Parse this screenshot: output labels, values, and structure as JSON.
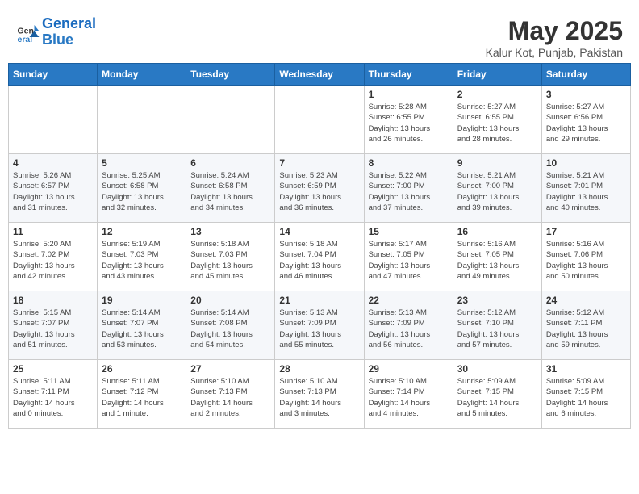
{
  "header": {
    "logo_line1": "General",
    "logo_line2": "Blue",
    "month": "May 2025",
    "location": "Kalur Kot, Punjab, Pakistan"
  },
  "days_of_week": [
    "Sunday",
    "Monday",
    "Tuesday",
    "Wednesday",
    "Thursday",
    "Friday",
    "Saturday"
  ],
  "weeks": [
    [
      {
        "day": "",
        "info": ""
      },
      {
        "day": "",
        "info": ""
      },
      {
        "day": "",
        "info": ""
      },
      {
        "day": "",
        "info": ""
      },
      {
        "day": "1",
        "info": "Sunrise: 5:28 AM\nSunset: 6:55 PM\nDaylight: 13 hours\nand 26 minutes."
      },
      {
        "day": "2",
        "info": "Sunrise: 5:27 AM\nSunset: 6:55 PM\nDaylight: 13 hours\nand 28 minutes."
      },
      {
        "day": "3",
        "info": "Sunrise: 5:27 AM\nSunset: 6:56 PM\nDaylight: 13 hours\nand 29 minutes."
      }
    ],
    [
      {
        "day": "4",
        "info": "Sunrise: 5:26 AM\nSunset: 6:57 PM\nDaylight: 13 hours\nand 31 minutes."
      },
      {
        "day": "5",
        "info": "Sunrise: 5:25 AM\nSunset: 6:58 PM\nDaylight: 13 hours\nand 32 minutes."
      },
      {
        "day": "6",
        "info": "Sunrise: 5:24 AM\nSunset: 6:58 PM\nDaylight: 13 hours\nand 34 minutes."
      },
      {
        "day": "7",
        "info": "Sunrise: 5:23 AM\nSunset: 6:59 PM\nDaylight: 13 hours\nand 36 minutes."
      },
      {
        "day": "8",
        "info": "Sunrise: 5:22 AM\nSunset: 7:00 PM\nDaylight: 13 hours\nand 37 minutes."
      },
      {
        "day": "9",
        "info": "Sunrise: 5:21 AM\nSunset: 7:00 PM\nDaylight: 13 hours\nand 39 minutes."
      },
      {
        "day": "10",
        "info": "Sunrise: 5:21 AM\nSunset: 7:01 PM\nDaylight: 13 hours\nand 40 minutes."
      }
    ],
    [
      {
        "day": "11",
        "info": "Sunrise: 5:20 AM\nSunset: 7:02 PM\nDaylight: 13 hours\nand 42 minutes."
      },
      {
        "day": "12",
        "info": "Sunrise: 5:19 AM\nSunset: 7:03 PM\nDaylight: 13 hours\nand 43 minutes."
      },
      {
        "day": "13",
        "info": "Sunrise: 5:18 AM\nSunset: 7:03 PM\nDaylight: 13 hours\nand 45 minutes."
      },
      {
        "day": "14",
        "info": "Sunrise: 5:18 AM\nSunset: 7:04 PM\nDaylight: 13 hours\nand 46 minutes."
      },
      {
        "day": "15",
        "info": "Sunrise: 5:17 AM\nSunset: 7:05 PM\nDaylight: 13 hours\nand 47 minutes."
      },
      {
        "day": "16",
        "info": "Sunrise: 5:16 AM\nSunset: 7:05 PM\nDaylight: 13 hours\nand 49 minutes."
      },
      {
        "day": "17",
        "info": "Sunrise: 5:16 AM\nSunset: 7:06 PM\nDaylight: 13 hours\nand 50 minutes."
      }
    ],
    [
      {
        "day": "18",
        "info": "Sunrise: 5:15 AM\nSunset: 7:07 PM\nDaylight: 13 hours\nand 51 minutes."
      },
      {
        "day": "19",
        "info": "Sunrise: 5:14 AM\nSunset: 7:07 PM\nDaylight: 13 hours\nand 53 minutes."
      },
      {
        "day": "20",
        "info": "Sunrise: 5:14 AM\nSunset: 7:08 PM\nDaylight: 13 hours\nand 54 minutes."
      },
      {
        "day": "21",
        "info": "Sunrise: 5:13 AM\nSunset: 7:09 PM\nDaylight: 13 hours\nand 55 minutes."
      },
      {
        "day": "22",
        "info": "Sunrise: 5:13 AM\nSunset: 7:09 PM\nDaylight: 13 hours\nand 56 minutes."
      },
      {
        "day": "23",
        "info": "Sunrise: 5:12 AM\nSunset: 7:10 PM\nDaylight: 13 hours\nand 57 minutes."
      },
      {
        "day": "24",
        "info": "Sunrise: 5:12 AM\nSunset: 7:11 PM\nDaylight: 13 hours\nand 59 minutes."
      }
    ],
    [
      {
        "day": "25",
        "info": "Sunrise: 5:11 AM\nSunset: 7:11 PM\nDaylight: 14 hours\nand 0 minutes."
      },
      {
        "day": "26",
        "info": "Sunrise: 5:11 AM\nSunset: 7:12 PM\nDaylight: 14 hours\nand 1 minute."
      },
      {
        "day": "27",
        "info": "Sunrise: 5:10 AM\nSunset: 7:13 PM\nDaylight: 14 hours\nand 2 minutes."
      },
      {
        "day": "28",
        "info": "Sunrise: 5:10 AM\nSunset: 7:13 PM\nDaylight: 14 hours\nand 3 minutes."
      },
      {
        "day": "29",
        "info": "Sunrise: 5:10 AM\nSunset: 7:14 PM\nDaylight: 14 hours\nand 4 minutes."
      },
      {
        "day": "30",
        "info": "Sunrise: 5:09 AM\nSunset: 7:15 PM\nDaylight: 14 hours\nand 5 minutes."
      },
      {
        "day": "31",
        "info": "Sunrise: 5:09 AM\nSunset: 7:15 PM\nDaylight: 14 hours\nand 6 minutes."
      }
    ]
  ]
}
